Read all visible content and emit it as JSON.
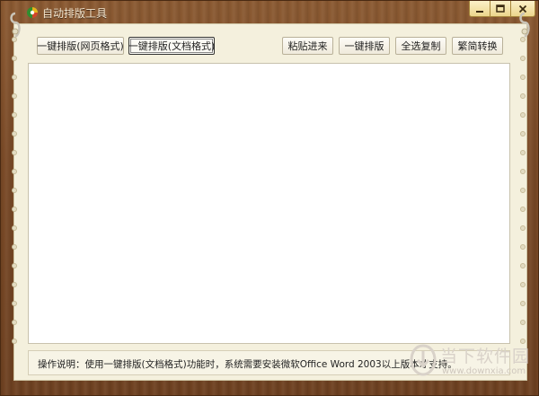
{
  "window": {
    "title": "自动排版工具",
    "controls": [
      "minimize",
      "maximize",
      "close"
    ]
  },
  "toolbar": {
    "left_buttons": [
      {
        "label": "一键排版(网页格式)"
      },
      {
        "label": "一键排版(文档格式)",
        "active": true
      }
    ],
    "right_buttons": [
      {
        "label": "粘贴进来"
      },
      {
        "label": "一键排版"
      },
      {
        "label": "全选复制"
      },
      {
        "label": "繁简转换"
      }
    ]
  },
  "editor": {
    "content": ""
  },
  "footer": {
    "note": "操作说明：使用一键排版(文档格式)功能时，系统需要安装微软Office Word 2003以上版本才支持。"
  },
  "watermark": {
    "name": "当下软件园",
    "url": "www.downxia.com"
  },
  "colors": {
    "wood": "#7a4a27",
    "paper": "#f4f0dd",
    "editor_bg": "#ffffff",
    "window_button": "#ecd68c"
  }
}
